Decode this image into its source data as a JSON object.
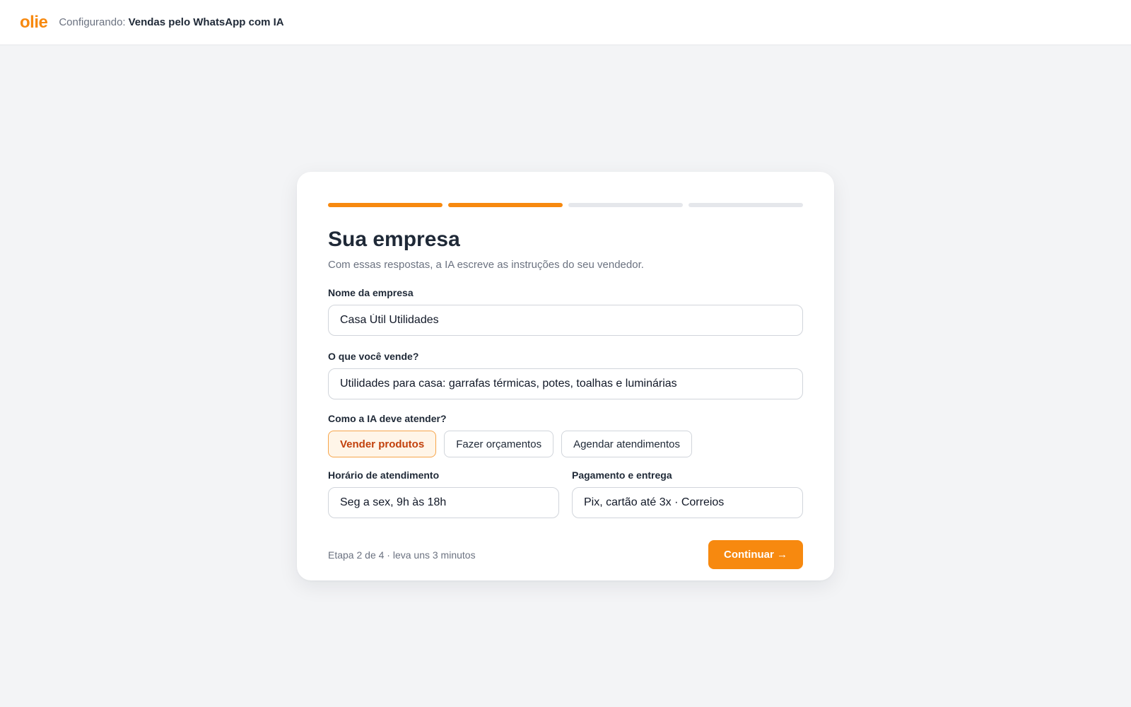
{
  "header": {
    "logo": "olie",
    "config_prefix": "Configurando:",
    "config_title": "Vendas pelo WhatsApp com IA"
  },
  "progress": {
    "current_step": 2,
    "total_steps": 4
  },
  "form": {
    "title": "Sua empresa",
    "subtitle": "Com essas respostas, a IA escreve as instruções do seu vendedor.",
    "company_name": {
      "label": "Nome da empresa",
      "value": "Casa Útil Utilidades"
    },
    "what_sells": {
      "label": "O que você vende?",
      "value": "Utilidades para casa: garrafas térmicas, potes, toalhas e luminárias"
    },
    "mode": {
      "label": "Como a IA deve atender?",
      "options": [
        "Vender produtos",
        "Fazer orçamentos",
        "Agendar atendimentos"
      ],
      "selected": "Vender produtos"
    },
    "hours": {
      "label": "Horário de atendimento",
      "value": "Seg a sex, 9h às 18h"
    },
    "payment": {
      "label": "Pagamento e entrega",
      "value": "Pix, cartão até 3x · Correios"
    }
  },
  "footer": {
    "step_info": "Etapa 2 de 4 · leva uns 3 minutos",
    "continue_label": "Continuar →"
  },
  "colors": {
    "accent": "#f7890f",
    "selected_bg": "#fff5e8",
    "selected_text": "#c2410c"
  }
}
